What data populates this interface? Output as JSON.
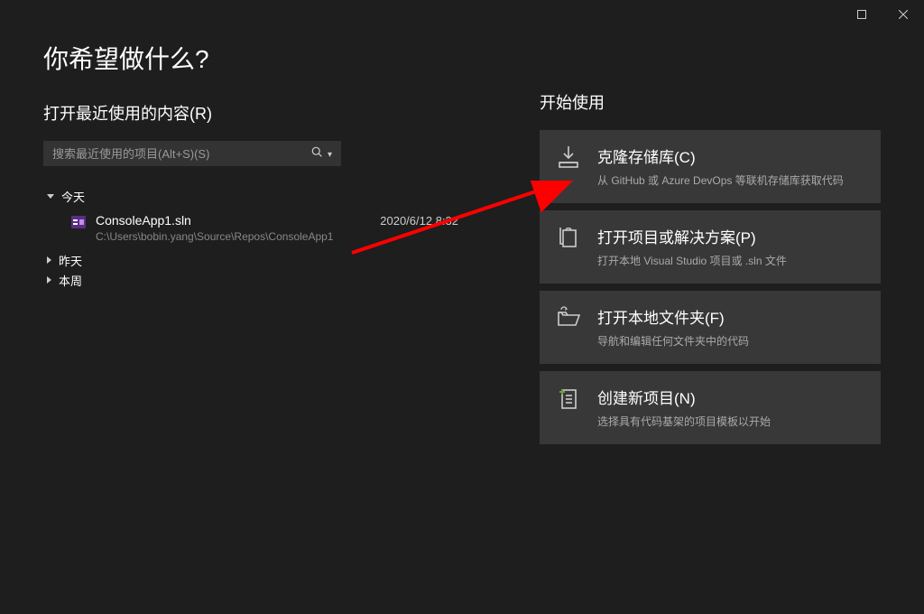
{
  "titlebar": {},
  "heading": "你希望做什么?",
  "recent": {
    "title": "打开最近使用的内容(R)",
    "search_placeholder": "搜索最近使用的项目(Alt+S)(S)",
    "groups": [
      {
        "label": "今天",
        "expanded": true,
        "items": [
          {
            "name": "ConsoleApp1.sln",
            "path": "C:\\Users\\bobin.yang\\Source\\Repos\\ConsoleApp1",
            "date": "2020/6/12 8:32"
          }
        ]
      },
      {
        "label": "昨天",
        "expanded": false,
        "items": []
      },
      {
        "label": "本周",
        "expanded": false,
        "items": []
      }
    ]
  },
  "start": {
    "title": "开始使用",
    "actions": [
      {
        "title": "克隆存储库(C)",
        "desc": "从 GitHub 或 Azure DevOps 等联机存储库获取代码"
      },
      {
        "title": "打开项目或解决方案(P)",
        "desc": "打开本地 Visual Studio 项目或 .sln 文件"
      },
      {
        "title": "打开本地文件夹(F)",
        "desc": "导航和编辑任何文件夹中的代码"
      },
      {
        "title": "创建新项目(N)",
        "desc": "选择具有代码基架的项目模板以开始"
      }
    ]
  }
}
